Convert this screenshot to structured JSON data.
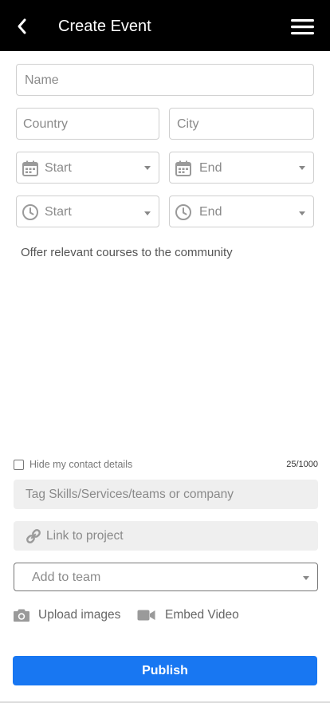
{
  "header": {
    "title": "Create Event"
  },
  "form": {
    "name_placeholder": "Name",
    "country_placeholder": "Country",
    "city_placeholder": "City",
    "start_date_placeholder": "Start",
    "end_date_placeholder": "End",
    "start_time_placeholder": "Start",
    "end_time_placeholder": "End",
    "description": "Offer relevant courses to the community",
    "hide_contact_label": "Hide my contact details",
    "char_counter": "25/1000",
    "tags_placeholder": "Tag Skills/Services/teams or company",
    "project_placeholder": "Link to project",
    "team_placeholder": "Add to team",
    "upload_images_label": "Upload images",
    "embed_video_label": "Embed Video",
    "publish_label": "Publish"
  },
  "colors": {
    "header_bg": "#000000",
    "primary": "#1877f2"
  },
  "icons": {
    "back": "chevron-left-icon",
    "menu": "hamburger-menu-icon",
    "date": "calendar-icon",
    "time": "clock-icon",
    "link": "link-icon",
    "camera": "camera-icon",
    "video": "video-camera-icon"
  }
}
